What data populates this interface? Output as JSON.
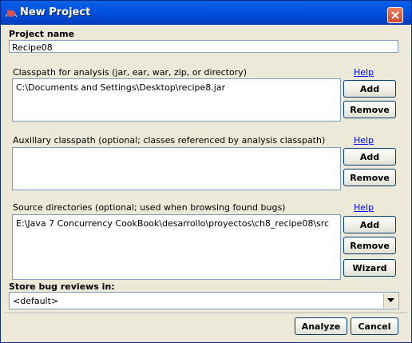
{
  "window": {
    "title": "New Project"
  },
  "project_name": {
    "label": "Project name",
    "value": "Recipe08"
  },
  "classpath": {
    "label": "Classpath for analysis (jar, ear, war, zip, or directory)",
    "help": "Help",
    "items": [
      "C:\\Documents and Settings\\Desktop\\recipe8.jar"
    ],
    "add_label": "Add",
    "remove_label": "Remove"
  },
  "aux_classpath": {
    "label": "Auxillary classpath (optional; classes referenced by analysis classpath)",
    "help": "Help",
    "items": [],
    "add_label": "Add",
    "remove_label": "Remove"
  },
  "source_dirs": {
    "label": "Source directories (optional; used when browsing found bugs)",
    "help": "Help",
    "items": [
      "E:\\Java 7 Concurrency CookBook\\desarrollo\\proyectos\\ch8_recipe08\\src"
    ],
    "add_label": "Add",
    "remove_label": "Remove",
    "wizard_label": "Wizard"
  },
  "store_reviews": {
    "label": "Store bug reviews in:",
    "value": "<default>"
  },
  "footer": {
    "analyze_label": "Analyze",
    "cancel_label": "Cancel"
  },
  "colors": {
    "titlebar": "#0054e3",
    "link": "#0000ff",
    "close": "#cf4b2d"
  }
}
